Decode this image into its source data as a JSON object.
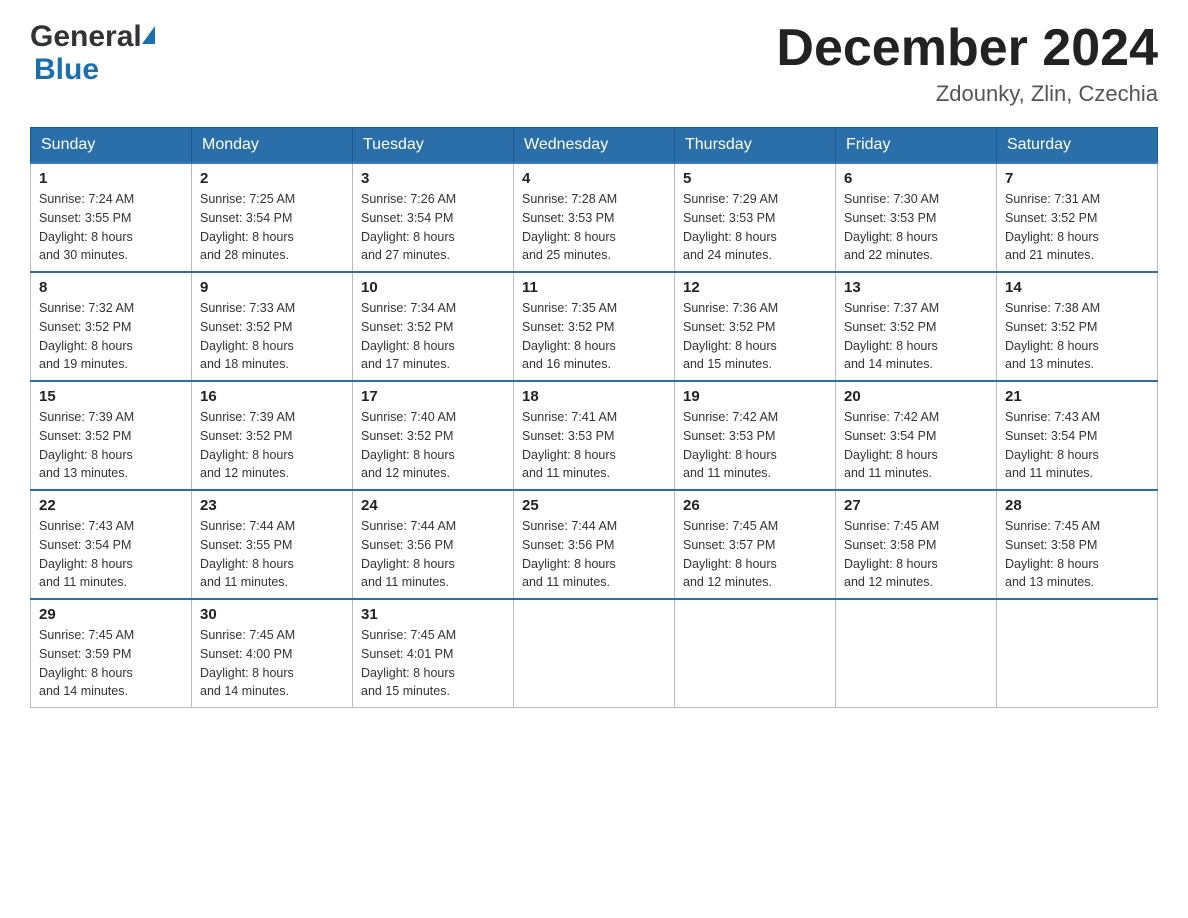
{
  "logo": {
    "general": "General",
    "blue": "Blue"
  },
  "title": {
    "month_year": "December 2024",
    "location": "Zdounky, Zlin, Czechia"
  },
  "weekdays": [
    "Sunday",
    "Monday",
    "Tuesday",
    "Wednesday",
    "Thursday",
    "Friday",
    "Saturday"
  ],
  "weeks": [
    [
      {
        "day": "1",
        "sunrise": "7:24 AM",
        "sunset": "3:55 PM",
        "daylight": "8 hours and 30 minutes."
      },
      {
        "day": "2",
        "sunrise": "7:25 AM",
        "sunset": "3:54 PM",
        "daylight": "8 hours and 28 minutes."
      },
      {
        "day": "3",
        "sunrise": "7:26 AM",
        "sunset": "3:54 PM",
        "daylight": "8 hours and 27 minutes."
      },
      {
        "day": "4",
        "sunrise": "7:28 AM",
        "sunset": "3:53 PM",
        "daylight": "8 hours and 25 minutes."
      },
      {
        "day": "5",
        "sunrise": "7:29 AM",
        "sunset": "3:53 PM",
        "daylight": "8 hours and 24 minutes."
      },
      {
        "day": "6",
        "sunrise": "7:30 AM",
        "sunset": "3:53 PM",
        "daylight": "8 hours and 22 minutes."
      },
      {
        "day": "7",
        "sunrise": "7:31 AM",
        "sunset": "3:52 PM",
        "daylight": "8 hours and 21 minutes."
      }
    ],
    [
      {
        "day": "8",
        "sunrise": "7:32 AM",
        "sunset": "3:52 PM",
        "daylight": "8 hours and 19 minutes."
      },
      {
        "day": "9",
        "sunrise": "7:33 AM",
        "sunset": "3:52 PM",
        "daylight": "8 hours and 18 minutes."
      },
      {
        "day": "10",
        "sunrise": "7:34 AM",
        "sunset": "3:52 PM",
        "daylight": "8 hours and 17 minutes."
      },
      {
        "day": "11",
        "sunrise": "7:35 AM",
        "sunset": "3:52 PM",
        "daylight": "8 hours and 16 minutes."
      },
      {
        "day": "12",
        "sunrise": "7:36 AM",
        "sunset": "3:52 PM",
        "daylight": "8 hours and 15 minutes."
      },
      {
        "day": "13",
        "sunrise": "7:37 AM",
        "sunset": "3:52 PM",
        "daylight": "8 hours and 14 minutes."
      },
      {
        "day": "14",
        "sunrise": "7:38 AM",
        "sunset": "3:52 PM",
        "daylight": "8 hours and 13 minutes."
      }
    ],
    [
      {
        "day": "15",
        "sunrise": "7:39 AM",
        "sunset": "3:52 PM",
        "daylight": "8 hours and 13 minutes."
      },
      {
        "day": "16",
        "sunrise": "7:39 AM",
        "sunset": "3:52 PM",
        "daylight": "8 hours and 12 minutes."
      },
      {
        "day": "17",
        "sunrise": "7:40 AM",
        "sunset": "3:52 PM",
        "daylight": "8 hours and 12 minutes."
      },
      {
        "day": "18",
        "sunrise": "7:41 AM",
        "sunset": "3:53 PM",
        "daylight": "8 hours and 11 minutes."
      },
      {
        "day": "19",
        "sunrise": "7:42 AM",
        "sunset": "3:53 PM",
        "daylight": "8 hours and 11 minutes."
      },
      {
        "day": "20",
        "sunrise": "7:42 AM",
        "sunset": "3:54 PM",
        "daylight": "8 hours and 11 minutes."
      },
      {
        "day": "21",
        "sunrise": "7:43 AM",
        "sunset": "3:54 PM",
        "daylight": "8 hours and 11 minutes."
      }
    ],
    [
      {
        "day": "22",
        "sunrise": "7:43 AM",
        "sunset": "3:54 PM",
        "daylight": "8 hours and 11 minutes."
      },
      {
        "day": "23",
        "sunrise": "7:44 AM",
        "sunset": "3:55 PM",
        "daylight": "8 hours and 11 minutes."
      },
      {
        "day": "24",
        "sunrise": "7:44 AM",
        "sunset": "3:56 PM",
        "daylight": "8 hours and 11 minutes."
      },
      {
        "day": "25",
        "sunrise": "7:44 AM",
        "sunset": "3:56 PM",
        "daylight": "8 hours and 11 minutes."
      },
      {
        "day": "26",
        "sunrise": "7:45 AM",
        "sunset": "3:57 PM",
        "daylight": "8 hours and 12 minutes."
      },
      {
        "day": "27",
        "sunrise": "7:45 AM",
        "sunset": "3:58 PM",
        "daylight": "8 hours and 12 minutes."
      },
      {
        "day": "28",
        "sunrise": "7:45 AM",
        "sunset": "3:58 PM",
        "daylight": "8 hours and 13 minutes."
      }
    ],
    [
      {
        "day": "29",
        "sunrise": "7:45 AM",
        "sunset": "3:59 PM",
        "daylight": "8 hours and 14 minutes."
      },
      {
        "day": "30",
        "sunrise": "7:45 AM",
        "sunset": "4:00 PM",
        "daylight": "8 hours and 14 minutes."
      },
      {
        "day": "31",
        "sunrise": "7:45 AM",
        "sunset": "4:01 PM",
        "daylight": "8 hours and 15 minutes."
      },
      null,
      null,
      null,
      null
    ]
  ],
  "labels": {
    "sunrise": "Sunrise:",
    "sunset": "Sunset:",
    "daylight": "Daylight:"
  }
}
